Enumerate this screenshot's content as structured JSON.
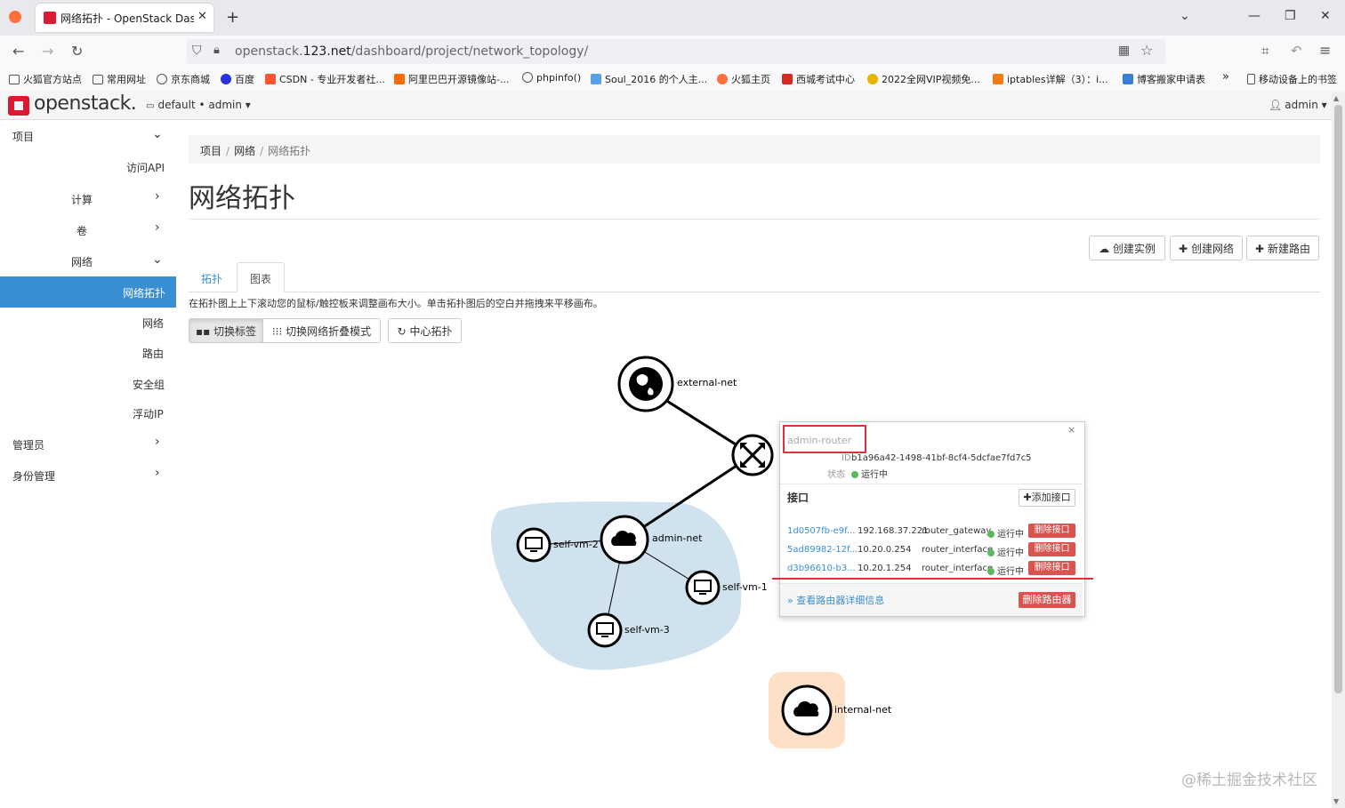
{
  "browser": {
    "tab_title": "网络拓扑 - OpenStack Dashboard",
    "url_prefix": "openstack.",
    "url_host": "123.net",
    "url_path": "/dashboard/project/network_topology/",
    "bookmarks": [
      "火狐官方站点",
      "常用网址",
      "京东商城",
      "百度",
      "CSDN - 专业开发者社...",
      "阿里巴巴开源镜像站-...",
      "phpinfo()",
      "Soul_2016 的个人主...",
      "火狐主页",
      "西城考试中心",
      "2022全网VIP视频免...",
      "iptables详解（3）：i...",
      "博客搬家申请表"
    ],
    "mobile_bookmarks": "移动设备上的书签"
  },
  "header": {
    "logo": "openstack.",
    "project": "default • admin ▾",
    "user": "admin ▾"
  },
  "sidebar": {
    "project": "项目",
    "access_api": "访问API",
    "compute": "计算",
    "volumes": "卷",
    "network": "网络",
    "network_topology": "网络拓扑",
    "networks": "网络",
    "routers": "路由",
    "security_groups": "安全组",
    "floating_ip": "浮动IP",
    "admin": "管理员",
    "identity": "身份管理"
  },
  "main": {
    "breadcrumb": [
      "项目",
      "网络",
      "网络拓扑"
    ],
    "title": "网络拓扑",
    "actions": {
      "create_instance": "创建实例",
      "create_network": "创建网络",
      "create_router": "新建路由"
    },
    "tabs": {
      "topology": "拓扑",
      "graph": "图表"
    },
    "help": "在拓扑图上上下滚动您的鼠标/触控板来调整画布大小。单击拓扑图后的空白并拖拽来平移画布。",
    "buttons": {
      "toggle_labels": "切换标签",
      "toggle_collapse": "切换网络折叠模式",
      "center": "中心拓扑"
    }
  },
  "topology": {
    "nodes": {
      "external_net": "external-net",
      "admin_net": "admin-net",
      "self_vm_1": "self-vm-1",
      "self_vm_2": "self-vm-2",
      "self_vm_3": "self-vm-3",
      "internal_net": "internal-net"
    },
    "colors": {
      "admin_net_area": "#cfe2ee",
      "internal_net_area": "#fde0c6"
    }
  },
  "popup": {
    "name": "admin-router",
    "id_label": "ID",
    "id_value": "b1a96a42-1498-41bf-8cf4-5dcfae7fd7c5",
    "status_label": "状态",
    "status_value": "运行中",
    "interfaces_title": "接口",
    "add_interface": "添加接口",
    "interfaces": [
      {
        "id": "1d0507fb-e9f...",
        "ip": "192.168.37.221",
        "type": "router_gateway",
        "status": "运行中",
        "action": "删除接口"
      },
      {
        "id": "5ad89982-12f...",
        "ip": "10.20.0.254",
        "type": "router_interface",
        "status": "运行中",
        "action": "删除接口"
      },
      {
        "id": "d3b96610-b3...",
        "ip": "10.20.1.254",
        "type": "router_interface",
        "status": "运行中",
        "action": "删除接口"
      }
    ],
    "view_details": "» 查看路由器详细信息",
    "delete_router": "删除路由器"
  },
  "watermark": "@稀土掘金技术社区"
}
